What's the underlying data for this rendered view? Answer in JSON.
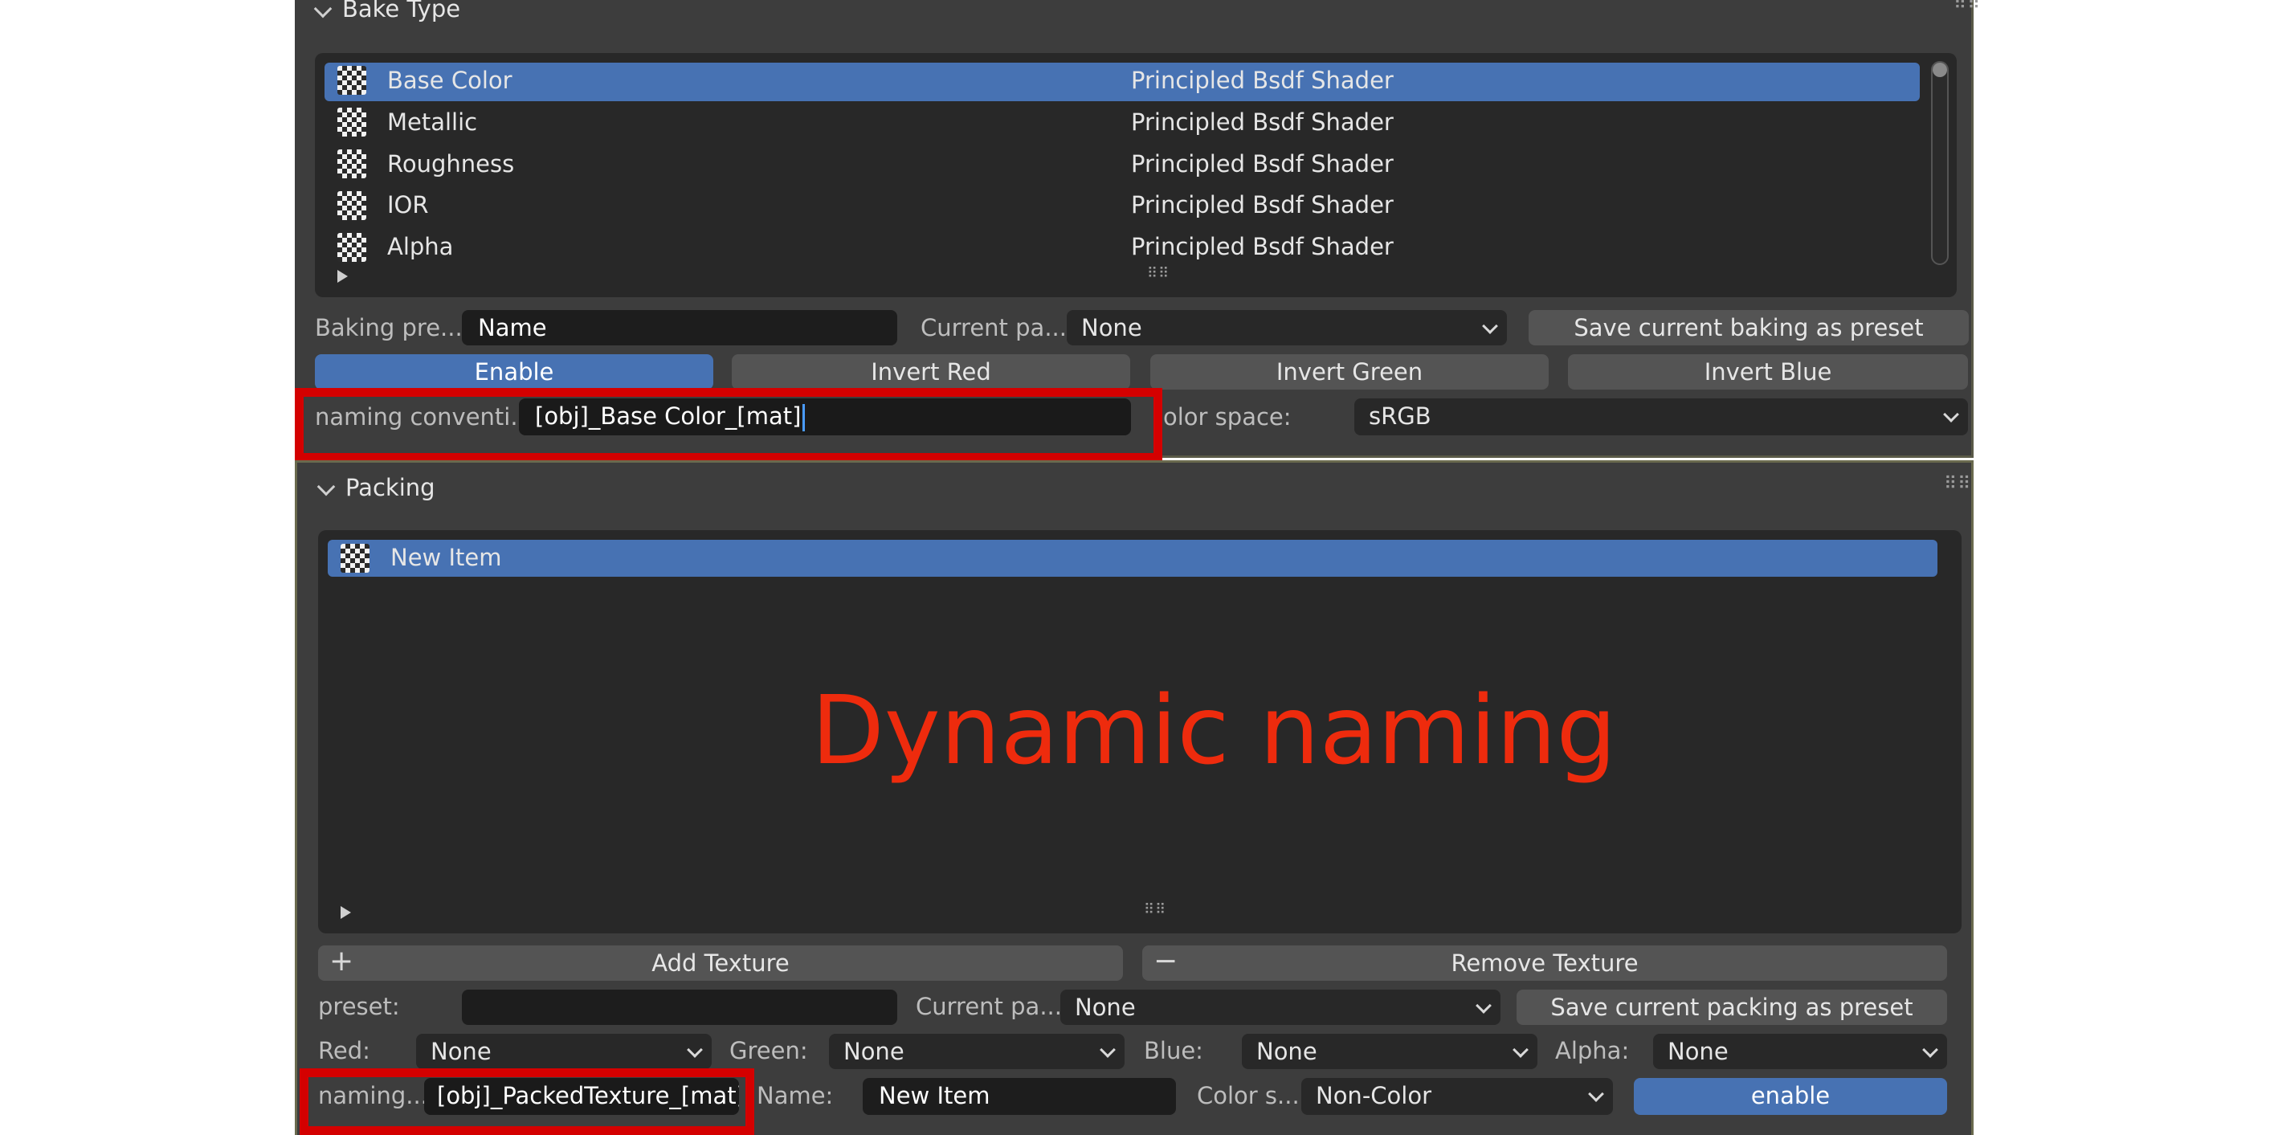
{
  "bake_type": {
    "title": "Bake Type",
    "items": [
      {
        "label": "Base Color",
        "shader": "Principled Bsdf Shader"
      },
      {
        "label": "Metallic",
        "shader": "Principled Bsdf Shader"
      },
      {
        "label": "Roughness",
        "shader": "Principled Bsdf Shader"
      },
      {
        "label": "IOR",
        "shader": "Principled Bsdf Shader"
      },
      {
        "label": "Alpha",
        "shader": "Principled Bsdf Shader"
      }
    ],
    "baking_preset_label": "Baking pre...",
    "baking_preset_value": "Name",
    "current_preset_label": "Current pa...",
    "current_preset_value": "None",
    "save_preset_label": "Save current baking as preset",
    "enable_label": "Enable",
    "invert_red_label": "Invert Red",
    "invert_green_label": "Invert Green",
    "invert_blue_label": "Invert Blue",
    "naming_label": "naming conventi...",
    "naming_value": "[obj]_Base Color_[mat]",
    "color_space_label": "olor space:",
    "color_space_value": "sRGB"
  },
  "packing": {
    "title": "Packing",
    "items": [
      {
        "label": "New Item"
      }
    ],
    "add_texture_label": "Add Texture",
    "remove_texture_label": "Remove Texture",
    "preset_label": "preset:",
    "preset_value": "",
    "current_preset_label": "Current pa...",
    "current_preset_value": "None",
    "save_preset_label": "Save current packing as preset",
    "red_label": "Red:",
    "red_value": "None",
    "green_label": "Green:",
    "green_value": "None",
    "blue_label": "Blue:",
    "blue_value": "None",
    "alpha_label": "Alpha:",
    "alpha_value": "None",
    "naming_label": "naming...",
    "naming_value": "[obj]_PackedTexture_[mat]",
    "name_label": "Name:",
    "name_value": "New Item",
    "color_space_label": "Color s...",
    "color_space_value": "Non-Color",
    "enable_label": "enable"
  },
  "overlay": {
    "caption": "Dynamic naming"
  },
  "colors": {
    "highlight_box": "#d40000",
    "selection": "#4772b3",
    "caption": "#ee2b0d"
  },
  "icons": {
    "texture": "checker-icon",
    "collapse": "chevron-down-icon",
    "grip": "drag-grip-icon"
  }
}
